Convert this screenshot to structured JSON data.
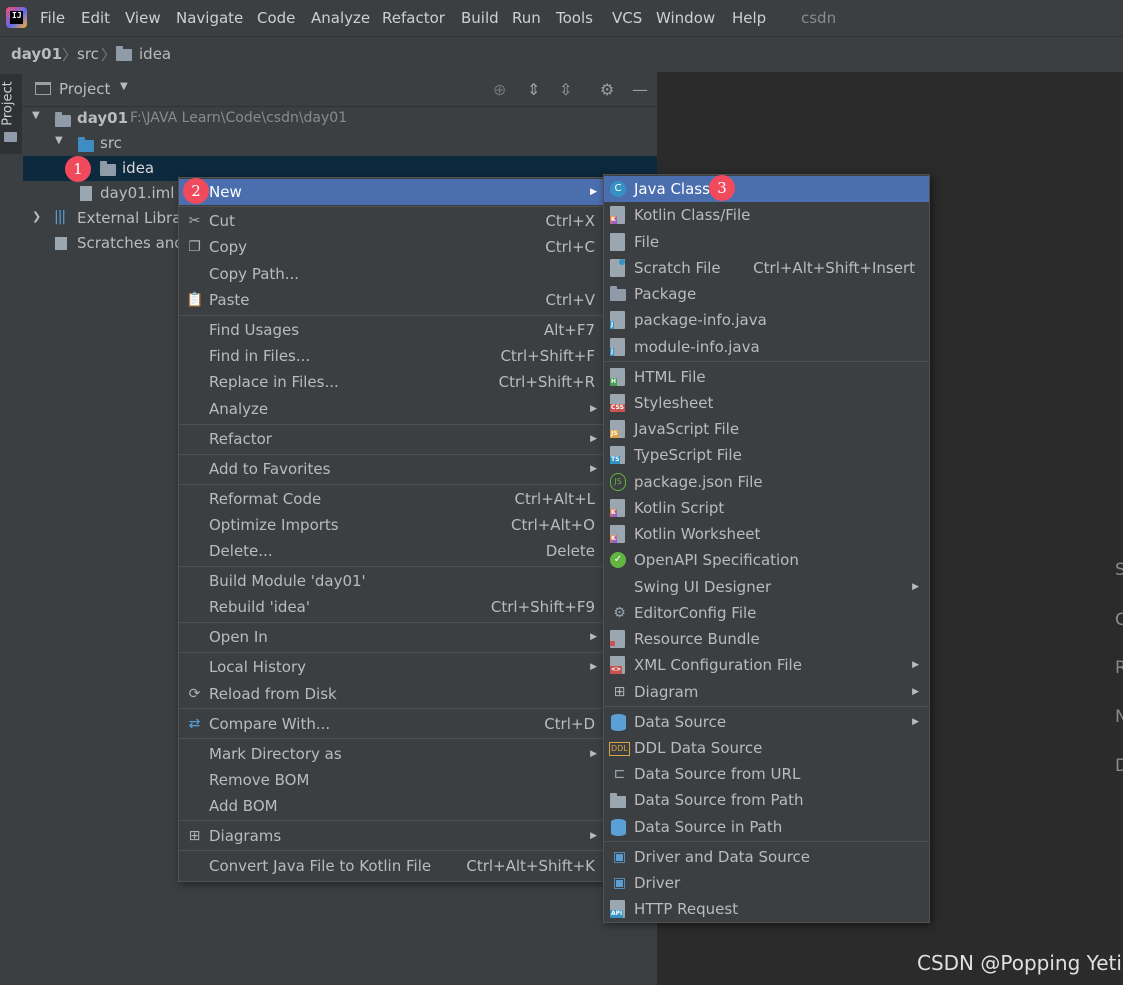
{
  "menubar": {
    "items": [
      "File",
      "Edit",
      "View",
      "Navigate",
      "Code",
      "Analyze",
      "Refactor",
      "Build",
      "Run",
      "Tools",
      "VCS",
      "Window",
      "Help"
    ],
    "project_name": "csdn"
  },
  "breadcrumb": [
    "day01",
    "src",
    "idea"
  ],
  "tool_window": {
    "strip_label": "Project",
    "title": "Project"
  },
  "tree": {
    "root": {
      "name": "day01",
      "path": "F:\\JAVA Learn\\Code\\csdn\\day01"
    },
    "src": "src",
    "idea": "idea",
    "iml": "day01.iml",
    "external": "External Librar",
    "scratches": "Scratches and"
  },
  "context_menu": [
    {
      "label": "New",
      "shortcut": "",
      "submenu": true,
      "icon": ""
    },
    {
      "label": "Cut",
      "shortcut": "Ctrl+X",
      "icon": "scissors-icon"
    },
    {
      "label": "Copy",
      "shortcut": "Ctrl+C",
      "icon": ""
    },
    {
      "label": "Copy Path...",
      "shortcut": "",
      "icon": ""
    },
    {
      "label": "Paste",
      "shortcut": "Ctrl+V",
      "icon": "clipboard-icon"
    },
    {
      "label": "Find Usages",
      "shortcut": "Alt+F7"
    },
    {
      "label": "Find in Files...",
      "shortcut": "Ctrl+Shift+F"
    },
    {
      "label": "Replace in Files...",
      "shortcut": "Ctrl+Shift+R"
    },
    {
      "label": "Analyze",
      "shortcut": "",
      "submenu": true
    },
    {
      "label": "Refactor",
      "shortcut": "",
      "submenu": true
    },
    {
      "label": "Add to Favorites",
      "shortcut": "",
      "submenu": true
    },
    {
      "label": "Reformat Code",
      "shortcut": "Ctrl+Alt+L"
    },
    {
      "label": "Optimize Imports",
      "shortcut": "Ctrl+Alt+O"
    },
    {
      "label": "Delete...",
      "shortcut": "Delete"
    },
    {
      "label": "Build Module 'day01'",
      "shortcut": ""
    },
    {
      "label": "Rebuild 'idea'",
      "shortcut": "Ctrl+Shift+F9"
    },
    {
      "label": "Open In",
      "shortcut": "",
      "submenu": true
    },
    {
      "label": "Local History",
      "shortcut": "",
      "submenu": true
    },
    {
      "label": "Reload from Disk",
      "shortcut": "",
      "icon": "reload-icon"
    },
    {
      "label": "Compare With...",
      "shortcut": "Ctrl+D",
      "icon": "compare-icon"
    },
    {
      "label": "Mark Directory as",
      "shortcut": "",
      "submenu": true
    },
    {
      "label": "Remove BOM",
      "shortcut": ""
    },
    {
      "label": "Add BOM",
      "shortcut": ""
    },
    {
      "label": "Diagrams",
      "shortcut": "",
      "submenu": true,
      "icon": "diagram-icon"
    },
    {
      "label": "Convert Java File to Kotlin File",
      "shortcut": "Ctrl+Alt+Shift+K"
    }
  ],
  "new_submenu": [
    {
      "label": "Java Class",
      "shortcut": "",
      "icon": "java-class-icon"
    },
    {
      "label": "Kotlin Class/File",
      "shortcut": "",
      "icon": "kotlin-file-icon"
    },
    {
      "label": "File",
      "shortcut": "",
      "icon": "file-icon"
    },
    {
      "label": "Scratch File",
      "shortcut": "Ctrl+Alt+Shift+Insert",
      "icon": "scratch-file-icon"
    },
    {
      "label": "Package",
      "shortcut": "",
      "icon": "package-icon"
    },
    {
      "label": "package-info.java",
      "shortcut": "",
      "icon": "java-file-icon"
    },
    {
      "label": "module-info.java",
      "shortcut": "",
      "icon": "java-file-icon"
    },
    {
      "label": "HTML File",
      "shortcut": "",
      "icon": "html-file-icon"
    },
    {
      "label": "Stylesheet",
      "shortcut": "",
      "icon": "css-file-icon"
    },
    {
      "label": "JavaScript File",
      "shortcut": "",
      "icon": "js-file-icon"
    },
    {
      "label": "TypeScript File",
      "shortcut": "",
      "icon": "ts-file-icon"
    },
    {
      "label": "package.json File",
      "shortcut": "",
      "icon": "nodejs-icon"
    },
    {
      "label": "Kotlin Script",
      "shortcut": "",
      "icon": "kotlin-script-icon"
    },
    {
      "label": "Kotlin Worksheet",
      "shortcut": "",
      "icon": "kotlin-worksheet-icon"
    },
    {
      "label": "OpenAPI Specification",
      "shortcut": "",
      "icon": "openapi-icon"
    },
    {
      "label": "Swing UI Designer",
      "shortcut": "",
      "submenu": true
    },
    {
      "label": "EditorConfig File",
      "shortcut": "",
      "icon": "gear-icon"
    },
    {
      "label": "Resource Bundle",
      "shortcut": "",
      "icon": "resource-bundle-icon"
    },
    {
      "label": "XML Configuration File",
      "shortcut": "",
      "submenu": true,
      "icon": "xml-file-icon"
    },
    {
      "label": "Diagram",
      "shortcut": "",
      "submenu": true,
      "icon": "diagram-icon"
    },
    {
      "label": "Data Source",
      "shortcut": "",
      "submenu": true,
      "icon": "database-icon"
    },
    {
      "label": "DDL Data Source",
      "shortcut": "",
      "icon": "ddl-icon"
    },
    {
      "label": "Data Source from URL",
      "shortcut": "",
      "icon": "url-icon"
    },
    {
      "label": "Data Source from Path",
      "shortcut": "",
      "icon": "folder-open-icon"
    },
    {
      "label": "Data Source in Path",
      "shortcut": "",
      "icon": "database-icon"
    },
    {
      "label": "Driver and Data Source",
      "shortcut": "",
      "icon": "driver-icon"
    },
    {
      "label": "Driver",
      "shortcut": "",
      "icon": "driver-icon"
    },
    {
      "label": "HTTP Request",
      "shortcut": "",
      "icon": "api-icon"
    }
  ],
  "annotations": [
    "1",
    "2",
    "3"
  ],
  "editor_letters": [
    "S",
    "C",
    "R",
    "N",
    "D"
  ],
  "watermark": "CSDN @Popping Yeti",
  "colors": {
    "selection": "#4b6eaf",
    "badge": "#f24a5d",
    "tree_selection": "#0d293e"
  }
}
